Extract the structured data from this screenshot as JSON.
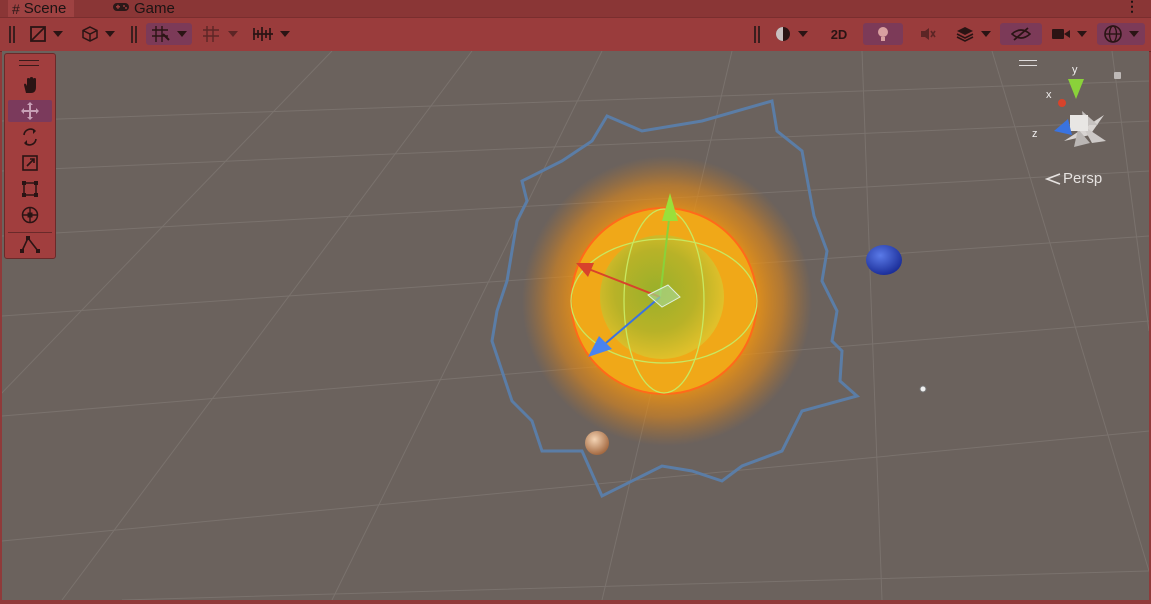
{
  "tabs": [
    {
      "label": "Scene",
      "icon": "hash-icon"
    },
    {
      "label": "Game",
      "icon": "gamepad-icon"
    }
  ],
  "toolbar": {
    "twod_label": "2D"
  },
  "viewport": {
    "projection_label": "Persp",
    "axis_labels": {
      "x": "x",
      "y": "y",
      "z": "z"
    },
    "background_color": "#6b625d"
  },
  "colors": {
    "toolbar_tint": "#9a3c3c",
    "active_tool": "#7b3a5c",
    "x_axis": "#d8432b",
    "y_axis": "#8ad23a",
    "z_axis": "#3a73e0"
  }
}
